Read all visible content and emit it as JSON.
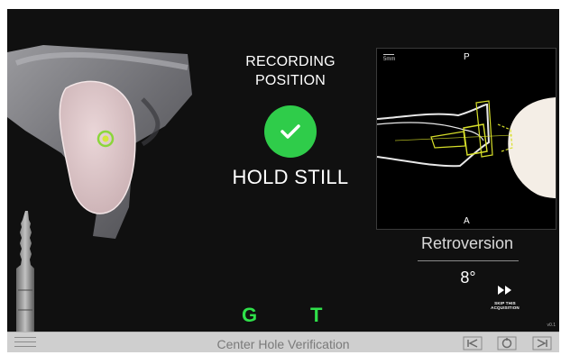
{
  "status": {
    "title": "RECORDING POSITION",
    "instruction": "HOLD STILL",
    "check_color": "#2fcc4a"
  },
  "ct_view": {
    "top_label": "P",
    "bottom_label": "A",
    "scale_label": "5mm"
  },
  "measurement": {
    "label": "Retroversion",
    "value": "8°"
  },
  "skip": {
    "label_line1": "SKIP THIS",
    "label_line2": "ACQUISITION"
  },
  "markers": {
    "g": "G",
    "t": "T",
    "color": "#2fe04a"
  },
  "version": "v0.1",
  "bottom_bar": {
    "title": "Center Hole Verification"
  },
  "icons": {
    "menu": "hamburger-icon",
    "previous": "previous-step-icon",
    "capture": "capture-icon",
    "next": "next-step-icon"
  }
}
